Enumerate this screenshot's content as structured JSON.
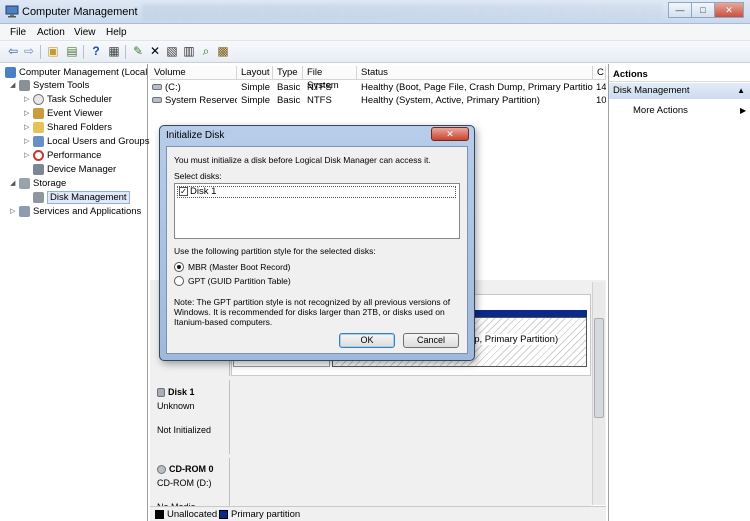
{
  "window": {
    "title": "Computer Management",
    "controls": {
      "minimize": "—",
      "maximize": "□",
      "close": "✕"
    }
  },
  "menu": [
    "File",
    "Action",
    "View",
    "Help"
  ],
  "tree": {
    "root": "Computer Management (Local",
    "system_tools": "System Tools",
    "items": [
      "Task Scheduler",
      "Event Viewer",
      "Shared Folders",
      "Local Users and Groups",
      "Performance",
      "Device Manager"
    ],
    "storage": "Storage",
    "disk_management": "Disk Management",
    "services": "Services and Applications"
  },
  "volumes": {
    "headers": [
      "Volume",
      "Layout",
      "Type",
      "File System",
      "Status",
      "C"
    ],
    "rows": [
      {
        "volume": "(C:)",
        "layout": "Simple",
        "type": "Basic",
        "fs": "NTFS",
        "status": "Healthy (Boot, Page File, Crash Dump, Primary Partition)",
        "cap": "14"
      },
      {
        "volume": "System Reserved",
        "layout": "Simple",
        "type": "Basic",
        "fs": "NTFS",
        "status": "Healthy (System, Active, Primary Partition)",
        "cap": "10"
      }
    ]
  },
  "graph": {
    "partition_text": "ump, Primary Partition)",
    "disk1": {
      "name": "Disk 1",
      "kind": "Unknown",
      "state": "Not Initialized"
    },
    "cdrom": {
      "name": "CD-ROM 0",
      "drive": "CD-ROM (D:)",
      "media": "No Media"
    }
  },
  "legend": {
    "unallocated": "Unallocated",
    "primary": "Primary partition",
    "colors": {
      "unallocated": "#000000",
      "primary": "#0a2a8a"
    }
  },
  "actions": {
    "header": "Actions",
    "section": "Disk Management",
    "more": "More Actions"
  },
  "dialog": {
    "title": "Initialize Disk",
    "message": "You must initialize a disk before Logical Disk Manager can access it.",
    "select_label": "Select disks:",
    "disk_item": "Disk 1",
    "disk_checked": true,
    "style_label": "Use the following partition style for the selected disks:",
    "options": [
      "MBR (Master Boot Record)",
      "GPT (GUID Partition Table)"
    ],
    "selected_option": "MBR (Master Boot Record)",
    "note_lines": [
      "Note: The GPT partition style is not recognized by all previous versions of",
      "Windows. It is recommended for disks larger than 2TB, or disks used on",
      "Itanium-based computers."
    ],
    "ok": "OK",
    "cancel": "Cancel"
  }
}
